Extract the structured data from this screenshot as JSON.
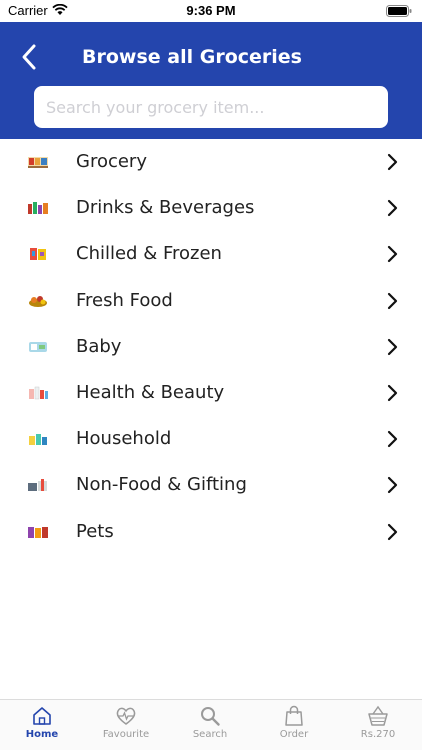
{
  "status_bar": {
    "carrier": "Carrier",
    "time": "9:36 PM"
  },
  "header": {
    "title": "Browse all Groceries"
  },
  "search": {
    "placeholder": "Search your grocery item..."
  },
  "categories": [
    {
      "label": "Grocery",
      "icon": "grocery-icon"
    },
    {
      "label": "Drinks & Beverages",
      "icon": "drinks-icon"
    },
    {
      "label": "Chilled & Frozen",
      "icon": "chilled-frozen-icon"
    },
    {
      "label": "Fresh Food",
      "icon": "fresh-food-icon"
    },
    {
      "label": "Baby",
      "icon": "baby-icon"
    },
    {
      "label": "Health & Beauty",
      "icon": "health-beauty-icon"
    },
    {
      "label": "Household",
      "icon": "household-icon"
    },
    {
      "label": "Non-Food & Gifting",
      "icon": "non-food-gifting-icon"
    },
    {
      "label": "Pets",
      "icon": "pets-icon"
    }
  ],
  "tabs": [
    {
      "label": "Home",
      "icon": "home-icon",
      "active": true
    },
    {
      "label": "Favourite",
      "icon": "heart-pulse-icon",
      "active": false
    },
    {
      "label": "Search",
      "icon": "search-icon",
      "active": false
    },
    {
      "label": "Order",
      "icon": "shopping-bag-icon",
      "active": false
    },
    {
      "label": "Rs.270",
      "icon": "basket-icon",
      "active": false
    }
  ],
  "colors": {
    "header": "#2445ad",
    "active_tab": "#2445ad",
    "inactive_tab": "#9a9a9a"
  }
}
